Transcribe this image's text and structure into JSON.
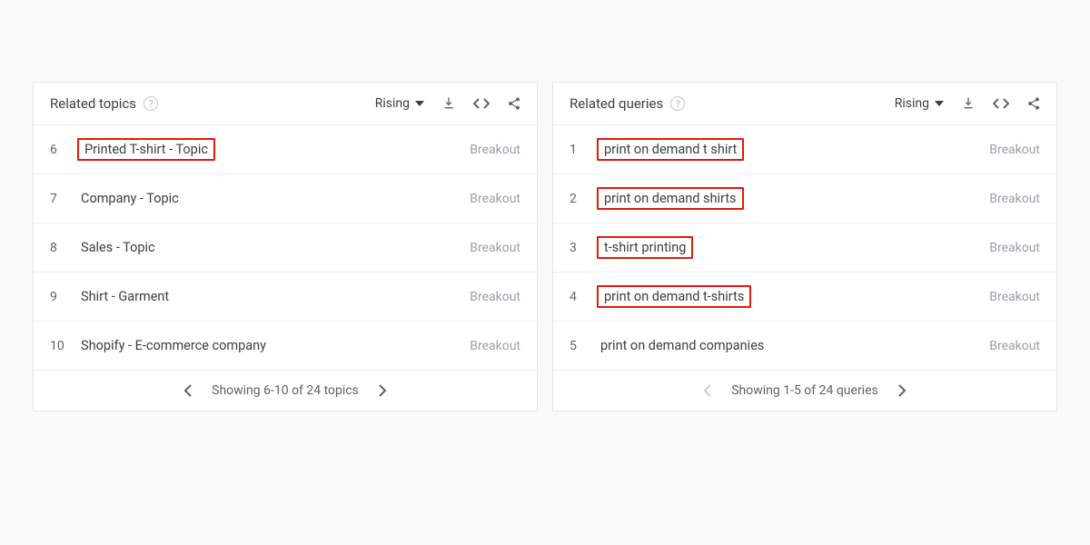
{
  "panels": [
    {
      "title": "Related topics",
      "sort_label": "Rising",
      "rows": [
        {
          "rank": "6",
          "label": "Printed T-shirt - Topic",
          "value": "Breakout",
          "highlighted": true
        },
        {
          "rank": "7",
          "label": "Company - Topic",
          "value": "Breakout",
          "highlighted": false
        },
        {
          "rank": "8",
          "label": "Sales - Topic",
          "value": "Breakout",
          "highlighted": false
        },
        {
          "rank": "9",
          "label": "Shirt - Garment",
          "value": "Breakout",
          "highlighted": false
        },
        {
          "rank": "10",
          "label": "Shopify - E-commerce company",
          "value": "Breakout",
          "highlighted": false
        }
      ],
      "footer_text": "Showing 6-10 of 24 topics",
      "prev_enabled": true,
      "next_enabled": true
    },
    {
      "title": "Related queries",
      "sort_label": "Rising",
      "rows": [
        {
          "rank": "1",
          "label": "print on demand t shirt",
          "value": "Breakout",
          "highlighted": true
        },
        {
          "rank": "2",
          "label": "print on demand shirts",
          "value": "Breakout",
          "highlighted": true
        },
        {
          "rank": "3",
          "label": "t-shirt printing",
          "value": "Breakout",
          "highlighted": true
        },
        {
          "rank": "4",
          "label": "print on demand t-shirts",
          "value": "Breakout",
          "highlighted": true
        },
        {
          "rank": "5",
          "label": "print on demand companies",
          "value": "Breakout",
          "highlighted": false
        }
      ],
      "footer_text": "Showing 1-5 of 24 queries",
      "prev_enabled": false,
      "next_enabled": true
    }
  ]
}
